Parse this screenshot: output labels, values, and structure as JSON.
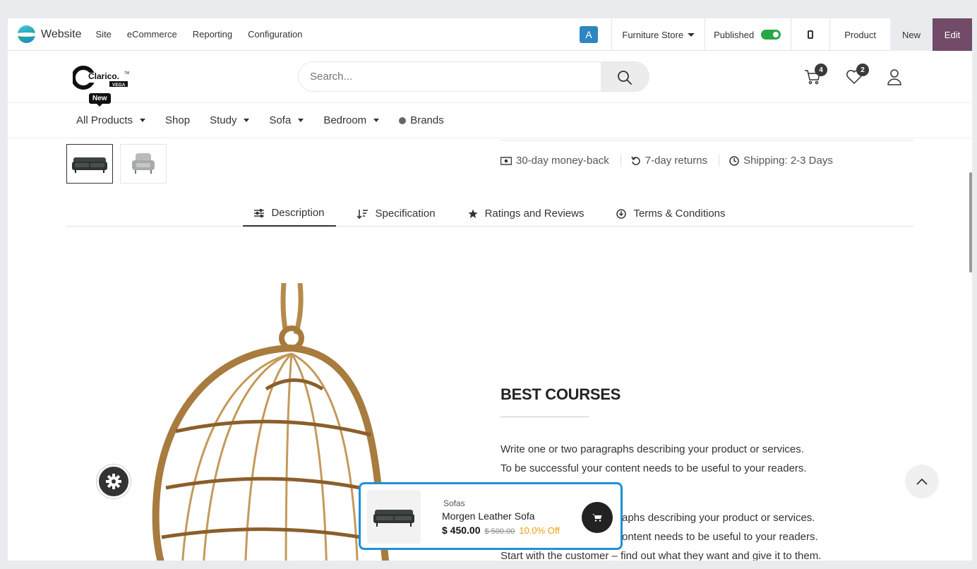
{
  "odoo_bar": {
    "brand": "Website",
    "menu": [
      "Site",
      "eCommerce",
      "Reporting",
      "Configuration"
    ],
    "avatar_letter": "A",
    "store": "Furniture Store",
    "published_label": "Published",
    "product_label": "Product",
    "new_label": "New",
    "edit_label": "Edit"
  },
  "header": {
    "logo_text": "Clarico",
    "logo_sub": "VEGA",
    "search_placeholder": "Search...",
    "cart_count": "4",
    "wishlist_count": "2"
  },
  "nav": {
    "new_tag": "New",
    "items": [
      "All Products",
      "Shop",
      "Study",
      "Sofa",
      "Bedroom",
      "Brands"
    ]
  },
  "features": [
    "30-day money-back",
    "7-day returns",
    "Shipping: 2-3 Days"
  ],
  "tabs": [
    "Description",
    "Specification",
    "Ratings and Reviews",
    "Terms & Conditions"
  ],
  "content": {
    "title": "BEST COURSES",
    "para1_l1": "Write one or two paragraphs describing your product or services.",
    "para1_l2": "To be successful your content needs to be useful to your readers.",
    "para2_l1": "aphs describing your product or services.",
    "para2_l2": "ontent needs to be useful to your readers.",
    "para2_l3": "Start with the customer – find out what they want and give it to them."
  },
  "sticky": {
    "category": "Sofas",
    "name": "Morgen Leather Sofa",
    "price": "$ 450.00",
    "old_price": "$ 500.00",
    "discount": "10.0% Off"
  },
  "colors": {
    "accent": "#714b67",
    "card_border": "#1e90d6",
    "discount": "#f39c12"
  }
}
